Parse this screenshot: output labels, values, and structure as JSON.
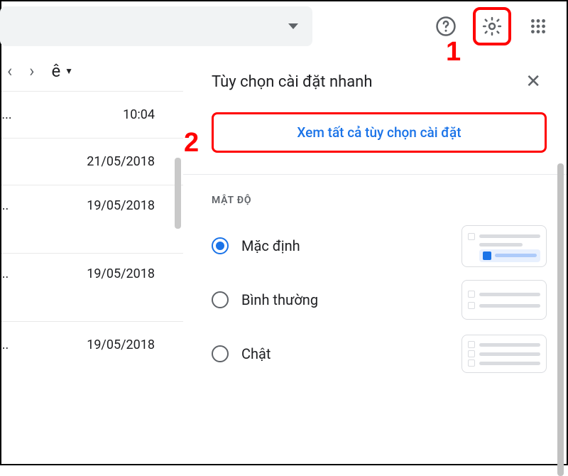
{
  "annotations": {
    "step1": "1",
    "step2": "2"
  },
  "list": {
    "rows": [
      {
        "text": "10:04",
        "dots": "i..."
      },
      {
        "text": "21/05/2018",
        "dots": ""
      },
      {
        "text": "19/05/2018",
        "dots": "..."
      },
      {
        "text": "19/05/2018",
        "dots": "..."
      },
      {
        "text": "19/05/2018",
        "dots": "..."
      }
    ],
    "nav_label": "ê"
  },
  "panel": {
    "title": "Tùy chọn cài đặt nhanh",
    "see_all": "Xem tất cả tùy chọn cài đặt",
    "density_heading": "MẬT ĐỘ",
    "options": [
      {
        "label": "Mặc định",
        "checked": true
      },
      {
        "label": "Bình thường",
        "checked": false
      },
      {
        "label": "Chật",
        "checked": false
      }
    ]
  }
}
